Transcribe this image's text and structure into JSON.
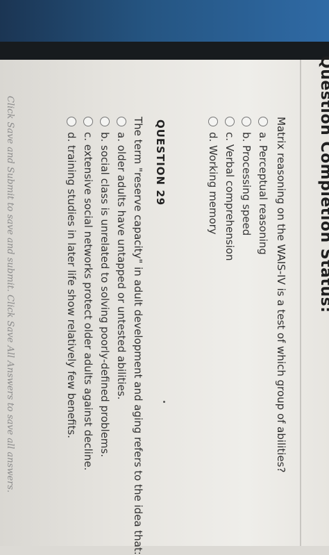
{
  "header": {
    "title": "Question Completion Status:"
  },
  "questions": [
    {
      "prompt": "Matrix reasoning on the WAIS-IV is a test of which group of abilities?",
      "options": [
        "a. Perceptual reasoning",
        "b. Processing speed",
        "c. Verbal comprehension",
        "d. Working memory"
      ]
    },
    {
      "title": "QUESTION 29",
      "prompt": "The term \"reserve capacity\" in adult development and aging refers to the idea that:",
      "options": [
        "a. older adults have untapped or untested abilities.",
        "b. social class is unrelated to solving poorly-defined problems.",
        "c. extensive social networks protect older adults against decline.",
        "d. training studies in later life show relatively few benefits."
      ]
    }
  ],
  "footer": {
    "text": "Click Save and Submit to save and submit. Click Save All Answers to save all answers."
  },
  "colors": {
    "top_band": "#255582",
    "dark_band": "#171b1e",
    "screen": "#e6e4df"
  }
}
